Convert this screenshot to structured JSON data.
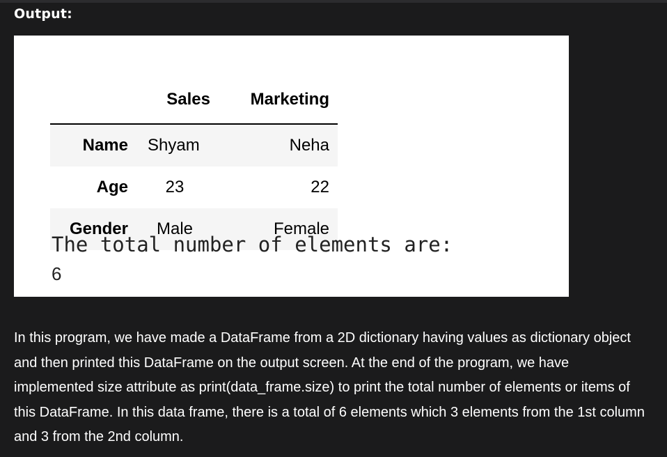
{
  "heading": "Output:",
  "output": {
    "table": {
      "columns": [
        "Sales",
        "Marketing"
      ],
      "rows": [
        {
          "index": "Name",
          "sales": "Shyam",
          "marketing": "Neha"
        },
        {
          "index": "Age",
          "sales": "23",
          "marketing": "22"
        },
        {
          "index": "Gender",
          "sales": "Male",
          "marketing": "Female"
        }
      ]
    },
    "printed_text": "The total number of elements are:",
    "printed_value": "6"
  },
  "explanation": "In this program, we have made a DataFrame from a 2D dictionary having values as dictionary object and then printed this DataFrame on the output screen. At the end of the program, we have implemented size attribute as print(data_frame.size) to print the total number of elements or items of this DataFrame. In this data frame, there is a total of 6 elements which 3 elements from the 1st column and 3 from the 2nd column.",
  "colors": {
    "page_background": "#1b1b1c",
    "output_background": "#ffffff",
    "striped_row": "#f5f5f5",
    "text_light": "#ffffff",
    "text_dark": "#000000"
  }
}
